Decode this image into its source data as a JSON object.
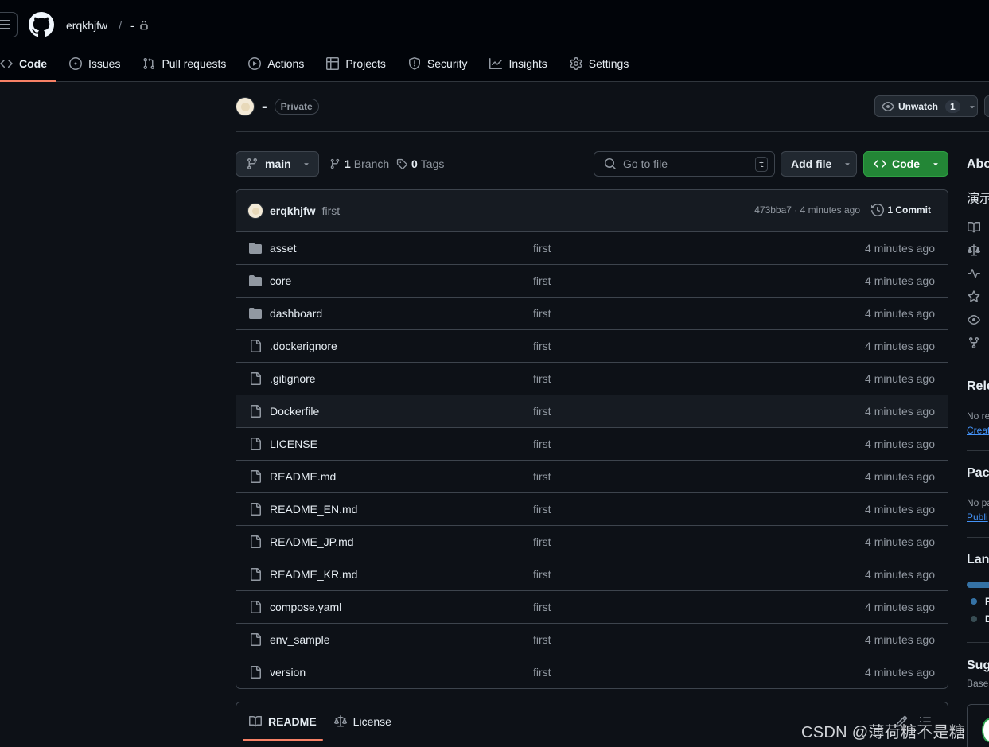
{
  "header": {
    "owner": "erqkhjfw",
    "separator": "/",
    "repo": "-",
    "tabs": [
      {
        "label": "Code",
        "icon": "code-icon",
        "selected": true
      },
      {
        "label": "Issues",
        "icon": "issue-icon"
      },
      {
        "label": "Pull requests",
        "icon": "pull-request-icon"
      },
      {
        "label": "Actions",
        "icon": "play-icon"
      },
      {
        "label": "Projects",
        "icon": "table-icon"
      },
      {
        "label": "Security",
        "icon": "shield-icon"
      },
      {
        "label": "Insights",
        "icon": "graph-icon"
      },
      {
        "label": "Settings",
        "icon": "gear-icon"
      }
    ]
  },
  "repo_title": {
    "name": "-",
    "visibility": "Private",
    "watch_label": "Unwatch",
    "watch_count": "1"
  },
  "toolbar": {
    "branch": "main",
    "branch_count": "1",
    "branch_label": "Branch",
    "tag_count": "0",
    "tag_label": "Tags",
    "search_placeholder": "Go to file",
    "search_shortcut": "t",
    "add_file": "Add file",
    "code": "Code"
  },
  "latest_commit": {
    "author": "erqkhjfw",
    "message": "first",
    "sha_time": "473bba7 · 4 minutes ago",
    "commits": "1 Commit"
  },
  "files": [
    {
      "name": "asset",
      "type": "dir",
      "message": "first",
      "time": "4 minutes ago"
    },
    {
      "name": "core",
      "type": "dir",
      "message": "first",
      "time": "4 minutes ago"
    },
    {
      "name": "dashboard",
      "type": "dir",
      "message": "first",
      "time": "4 minutes ago"
    },
    {
      "name": ".dockerignore",
      "type": "file",
      "message": "first",
      "time": "4 minutes ago"
    },
    {
      "name": ".gitignore",
      "type": "file",
      "message": "first",
      "time": "4 minutes ago"
    },
    {
      "name": "Dockerfile",
      "type": "file",
      "message": "first",
      "time": "4 minutes ago"
    },
    {
      "name": "LICENSE",
      "type": "file",
      "message": "first",
      "time": "4 minutes ago"
    },
    {
      "name": "README.md",
      "type": "file",
      "message": "first",
      "time": "4 minutes ago"
    },
    {
      "name": "README_EN.md",
      "type": "file",
      "message": "first",
      "time": "4 minutes ago"
    },
    {
      "name": "README_JP.md",
      "type": "file",
      "message": "first",
      "time": "4 minutes ago"
    },
    {
      "name": "README_KR.md",
      "type": "file",
      "message": "first",
      "time": "4 minutes ago"
    },
    {
      "name": "compose.yaml",
      "type": "file",
      "message": "first",
      "time": "4 minutes ago"
    },
    {
      "name": "env_sample",
      "type": "file",
      "message": "first",
      "time": "4 minutes ago"
    },
    {
      "name": "version",
      "type": "file",
      "message": "first",
      "time": "4 minutes ago"
    }
  ],
  "readme_tabs": [
    {
      "label": "README",
      "icon": "book-icon",
      "selected": true
    },
    {
      "label": "License",
      "icon": "law-icon"
    }
  ],
  "sidebar": {
    "about": "Abo",
    "description": "演示",
    "releases": "Rele",
    "releases_text": "No re",
    "releases_link": "Creat",
    "packages": "Pack",
    "packages_text": "No pa",
    "packages_link": "Publi",
    "languages": "Lang",
    "lang_1": "P",
    "lang_2": "D",
    "suggested": "Sug",
    "suggested_text": "Base"
  },
  "watermark": "CSDN @薄荷糖不是糖"
}
